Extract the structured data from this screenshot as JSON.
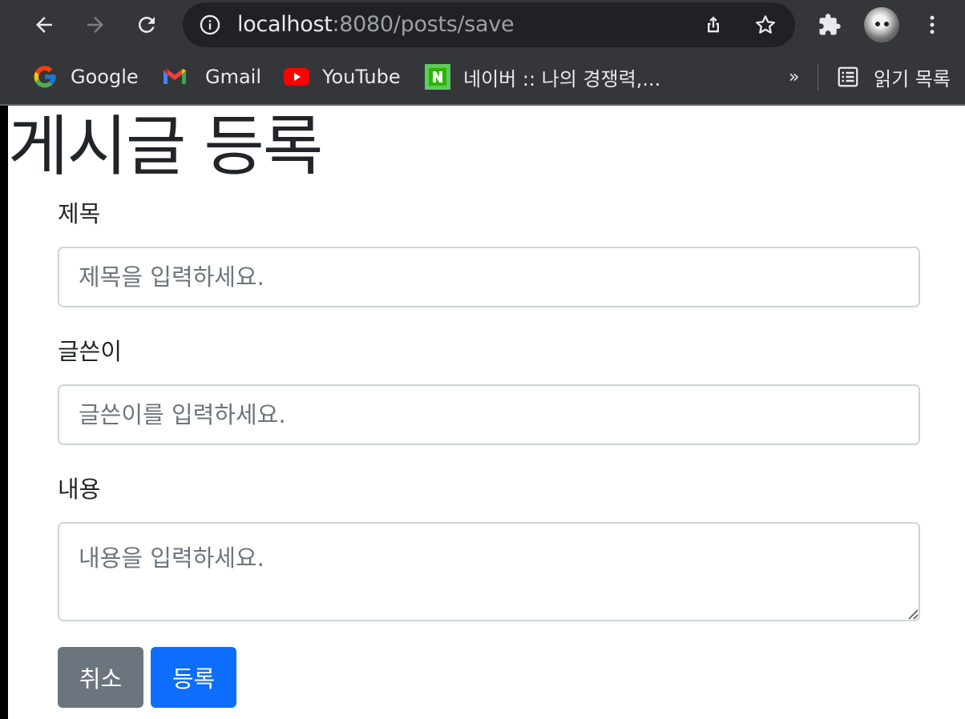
{
  "browser": {
    "url_host": "localhost",
    "url_rest": ":8080/posts/save",
    "bookmarks": [
      {
        "label": "Google",
        "icon": "google-icon"
      },
      {
        "label": "Gmail",
        "icon": "gmail-icon"
      },
      {
        "label": "YouTube",
        "icon": "youtube-icon"
      },
      {
        "label": "네이버 :: 나의 경쟁력,...",
        "icon": "naver-icon"
      }
    ],
    "overflow_label": "»",
    "reading_list_label": "읽기 목록"
  },
  "page": {
    "title": "게시글 등록",
    "form": {
      "title_label": "제목",
      "title_placeholder": "제목을 입력하세요.",
      "author_label": "글쓴이",
      "author_placeholder": "글쓴이를 입력하세요.",
      "content_label": "내용",
      "content_placeholder": "내용을 입력하세요."
    },
    "buttons": {
      "cancel": "취소",
      "save": "등록"
    }
  },
  "colors": {
    "primary": "#0d6efd",
    "secondary": "#6c757d",
    "chrome_bg": "#35363a"
  }
}
